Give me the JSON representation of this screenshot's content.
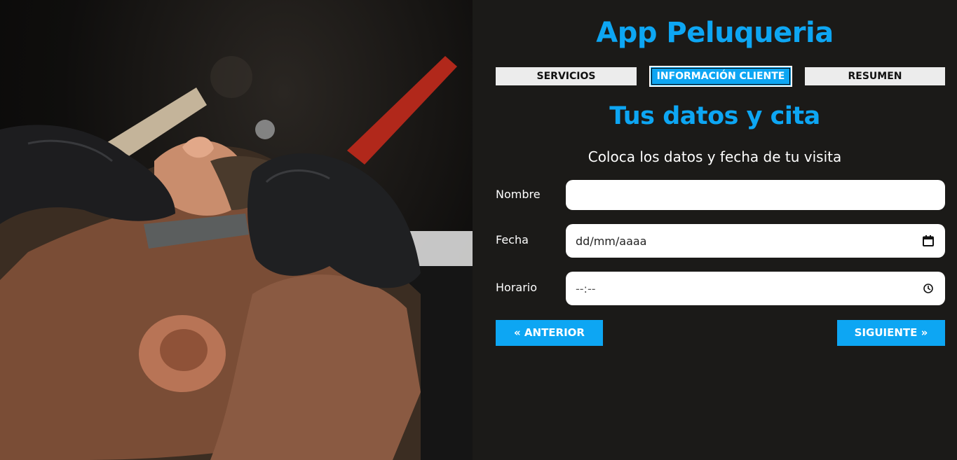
{
  "app": {
    "title": "App Peluqueria"
  },
  "hero": {
    "image_alt": "barber-shaving-client-photo"
  },
  "tabs": [
    {
      "label": "SERVICIOS",
      "active": false
    },
    {
      "label": "INFORMACIÓN CLIENTE",
      "active": true
    },
    {
      "label": "RESUMEN",
      "active": false
    }
  ],
  "section": {
    "title": "Tus datos y cita",
    "subtitle": "Coloca los datos y fecha de tu visita"
  },
  "form": {
    "nombre": {
      "label": "Nombre",
      "value": ""
    },
    "fecha": {
      "label": "Fecha",
      "placeholder": "dd/mm/aaaa",
      "icon": "calendar-icon"
    },
    "horario": {
      "label": "Horario",
      "placeholder": "--:--",
      "icon": "clock-icon"
    }
  },
  "buttons": {
    "prev_label": "« ANTERIOR",
    "next_label": "SIGUIENTE »"
  },
  "colors": {
    "accent": "#0da6f3",
    "background": "#1b1a18",
    "tab_inactive": "#ececec"
  }
}
